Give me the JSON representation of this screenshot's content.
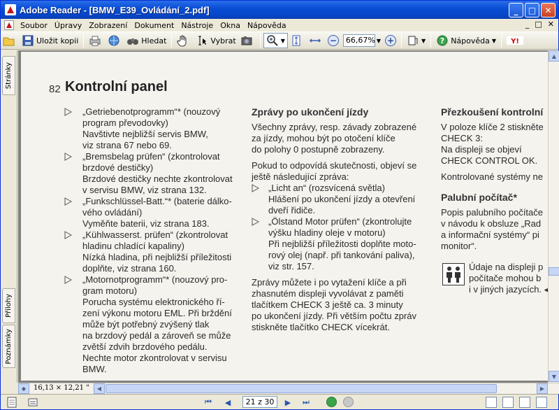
{
  "window": {
    "title": "Adobe Reader - [BMW_E39_Ovládání_2.pdf]",
    "min_label": "_",
    "max_label": "□",
    "close_label": "✕"
  },
  "menu": {
    "items": [
      "Soubor",
      "Úpravy",
      "Zobrazení",
      "Dokument",
      "Nástroje",
      "Okna",
      "Nápověda"
    ],
    "doc_controls": [
      "_",
      "□",
      "✕"
    ]
  },
  "toolbar": {
    "save_copy_label": "Uložit kopii",
    "search_label": "Hledat",
    "select_label": "Vybrat",
    "zoom_value": "66,67%",
    "help_label": "Nápověda"
  },
  "leftnav": {
    "pages_tab": "Stránky",
    "attachments_tab": "Přílohy",
    "comments_tab": "Poznámky"
  },
  "pdf": {
    "page_number": "82",
    "page_title": "Kontrolní panel",
    "col1": [
      {
        "bullet": true,
        "lines": [
          "„Getriebenotprogramm“* (nouzový",
          "program převodovky)"
        ]
      },
      {
        "bullet": false,
        "lines": [
          "Navštivte nejbližší servis BMW,",
          "viz strana 67 nebo 69."
        ]
      },
      {
        "bullet": true,
        "lines": [
          "„Bremsbelag prüfen“ (zkontrolovat",
          "brzdové destičky)"
        ]
      },
      {
        "bullet": false,
        "lines": [
          "Brzdové destičky nechte zkontrolovat",
          "v servisu BMW, viz strana 132."
        ]
      },
      {
        "bullet": true,
        "lines": [
          "„Funkschlüssel-Batt.“* (baterie dálko-",
          "vého ovládání)"
        ]
      },
      {
        "bullet": false,
        "lines": [
          "Vyměňte baterii, viz strana 183."
        ]
      },
      {
        "bullet": true,
        "lines": [
          "„Kühlwasserst. prüfen“ (zkontrolovat",
          "hladinu chladící kapaliny)"
        ]
      },
      {
        "bullet": false,
        "lines": [
          "Nízká hladina, při nejbližší příležitosti",
          "doplňte, viz strana 160."
        ]
      },
      {
        "bullet": true,
        "lines": [
          "„Motornotprogramm“* (nouzový pro-",
          "gram motoru)"
        ]
      },
      {
        "bullet": false,
        "lines": [
          "Porucha systému elektronického ří-",
          "zení výkonu motoru EML. Při brždění",
          "může být potřebný zvýšený tlak",
          "na brzdový pedál a zároveň se může",
          "zvětší zdvih brzdového pedálu.",
          "Nechte motor zkontrolovat v servisu",
          "BMW."
        ]
      }
    ],
    "col2_heading": "Zprávy po ukončení jízdy",
    "col2_p1": [
      "Všechny zprávy, resp. závady zobrazené",
      "za jízdy, mohou být po otočení klíče",
      "do polohy 0 postupně zobrazeny."
    ],
    "col2_p2": [
      "Pokud to odpovídá skutečnosti, objeví se",
      "ještě následující zpráva:"
    ],
    "col2_items": [
      {
        "bullet": true,
        "lines": [
          "„Licht an“ (rozsvícená světla)"
        ]
      },
      {
        "bullet": false,
        "lines": [
          "Hlášení po ukončení jízdy a otevření",
          "dveří řidiče."
        ]
      },
      {
        "bullet": true,
        "lines": [
          "„Ölstand Motor prüfen“ (zkontrolujte",
          "výšku hladiny oleje v motoru)"
        ]
      },
      {
        "bullet": false,
        "lines": [
          "Při nejbližší příležitosti doplňte moto-",
          "rový olej (např. při tankování paliva),",
          "viz str. 157."
        ]
      }
    ],
    "col2_p3": [
      "Zprávy můžete i po vytažení klíče a při",
      "zhasnutém displeji vyvolávat z paměti",
      "tlačítkem CHECK 3 ještě ca. 3 minuty",
      "po ukončení jízdy. Při větším počtu zpráv",
      "stiskněte tlačítko CHECK vícekrát."
    ],
    "col3_heading": "Přezkoušení kontrolní",
    "col3_p1": [
      "V poloze klíče 2 stiskněte",
      "CHECK 3:",
      "Na displeji se objeví",
      "CHECK CONTROL OK."
    ],
    "col3_p2": [
      "Kontrolované systémy ne"
    ],
    "col3_heading2": "Palubní počítač*",
    "col3_p3": [
      "Popis palubního počítače",
      "v návodu k obsluze „Rad",
      "a informační systémy“ pi",
      "monitor“."
    ],
    "col3_note": [
      "Údaje na displeji p",
      "počítače mohou b",
      "i v jiných jazycích. ◀"
    ]
  },
  "status": {
    "page_size": "16,13 × 12,21 \"",
    "page_indicator": "21 z 30"
  }
}
